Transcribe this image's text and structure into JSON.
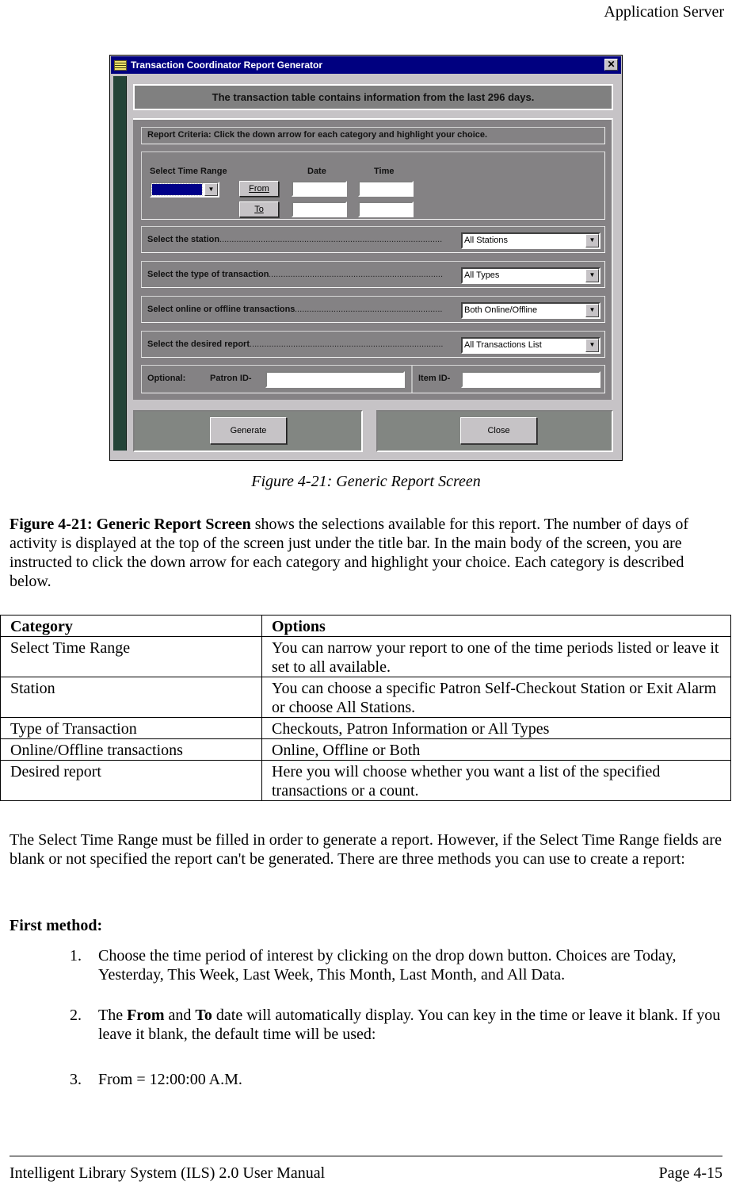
{
  "header": {
    "running_title": "Application Server"
  },
  "dialog": {
    "title": "Transaction Coordinator Report Generator",
    "close_glyph": "✕",
    "banner": "The transaction table contains information from the last 296 days.",
    "criteria_header": "Report Criteria:  Click the down arrow for each category and highlight your choice.",
    "time_range": {
      "label": "Select Time Range",
      "date_label": "Date",
      "time_label": "Time",
      "from_button": "From",
      "to_button": "To",
      "selected_value": "",
      "dropdown_glyph": "▼"
    },
    "rows": [
      {
        "label": "Select the station",
        "value": "All Stations"
      },
      {
        "label": "Select the type of transaction",
        "value": "All Types"
      },
      {
        "label": "Select online or offline transactions",
        "value": "Both Online/Offline"
      },
      {
        "label": "Select the desired report",
        "value": "All Transactions List"
      }
    ],
    "optional": {
      "label": "Optional:",
      "patron_label": "Patron ID-",
      "patron_value": "",
      "item_label": "Item ID-",
      "item_value": ""
    },
    "buttons": {
      "generate": "Generate",
      "close": "Close"
    }
  },
  "caption": "Figure 4-21: Generic Report Screen",
  "intro": {
    "bold_lead": "Figure 4-21: Generic Report Screen",
    "text": " shows the selections available for this report. The number of days of activity is displayed at the top of the screen just under the title bar. In the main body of the screen, you are instructed to click the down arrow for each category and highlight your choice. Each category is described below."
  },
  "table": {
    "headers": [
      "Category",
      "Options"
    ],
    "rows": [
      [
        "Select Time Range",
        "You can narrow your report to one of the time periods listed or leave it set to all available."
      ],
      [
        "Station",
        "You can choose a specific Patron Self-Checkout Station or Exit Alarm or choose All Stations."
      ],
      [
        "Type of Transaction",
        "Checkouts, Patron Information or All Types"
      ],
      [
        "Online/Offline transactions",
        "Online, Offline or Both"
      ],
      [
        "Desired report",
        "Here you will choose whether you want a list of the specified transactions or a count."
      ]
    ]
  },
  "para2": "The Select Time Range must be filled in order to generate a report. However, if the Select Time Range fields are blank or not specified the report can't be generated. There are three methods you can use to create a report:",
  "method_heading": "First method:",
  "steps": [
    {
      "num": "1.",
      "text": "Choose the time period of interest by clicking on the drop down button. Choices are Today, Yesterday, This Week, Last Week, This Month, Last Month, and All Data."
    },
    {
      "num": "2.",
      "pre": "The ",
      "bold1": "From",
      "mid": " and ",
      "bold2": "To",
      "post": " date will automatically display. You can key in the time or leave it blank. If you leave it blank, the default time will be used:"
    },
    {
      "num": "3.",
      "text": "From = 12:00:00 A.M."
    }
  ],
  "footer": {
    "left": "Intelligent Library System (ILS) 2.0 User Manual",
    "right": "Page 4-15"
  }
}
